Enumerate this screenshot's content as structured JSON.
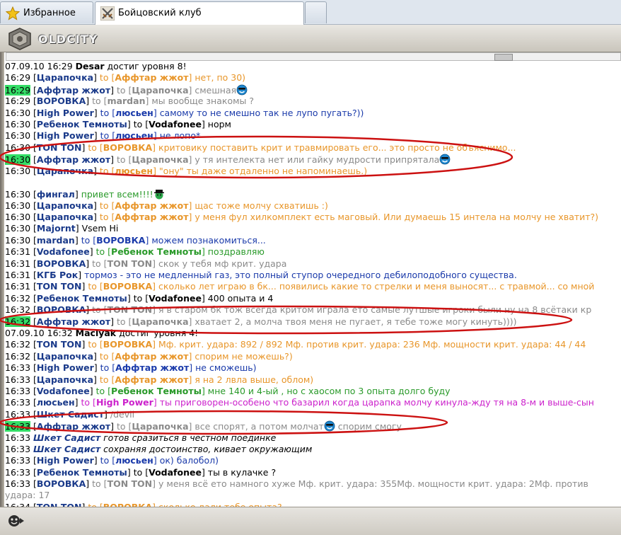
{
  "tabs": [
    {
      "label": "Избранное",
      "icon": "star-icon"
    },
    {
      "label": "Бойцовский клуб",
      "icon": "crossed-swords-icon"
    },
    {
      "label": "",
      "icon": "new-tab-icon"
    }
  ],
  "site": {
    "logo_text": "OLDCITY"
  },
  "colors": {
    "highlight_time": "#33dd66",
    "nick": "#1a3a8a",
    "target": "#8a8a8a",
    "circle": "#cc1111"
  },
  "messages": [
    {
      "time": "07.09.10 16:29",
      "hl": false,
      "nick": "Desar",
      "sys": true,
      "text": " достиг уровня 8!",
      "color": "#000000"
    },
    {
      "time": "16:29",
      "hl": false,
      "nick": "Царапочка",
      "to": "Аффтар жжот",
      "text": "нет, по 30)",
      "color": "#e8962a"
    },
    {
      "time": "16:29",
      "hl": true,
      "nick": "Аффтар жжот",
      "to": "Царапочка",
      "text": "смешная",
      "color": "#8a8a8a",
      "smile": "grin"
    },
    {
      "time": "16:29",
      "hl": false,
      "nick": "ВОРОВКА",
      "to": "mardan",
      "text": "мы вообще знакомы ?",
      "color": "#8a8a8a"
    },
    {
      "time": "16:30",
      "hl": false,
      "nick": "High Power",
      "to": "люсьен",
      "text": "самому то не смешно так не лупо пугать?))",
      "color": "#1a3aaa"
    },
    {
      "time": "16:30",
      "hl": false,
      "nick": "Ребенок Темноты",
      "to": "Vodafonee",
      "text": "норм",
      "color": "#000000"
    },
    {
      "time": "16:30",
      "hl": false,
      "nick": "High Power",
      "to": "люсьен",
      "text": "не лопо*",
      "color": "#1a3aaa"
    },
    {
      "time": "16:30",
      "hl": false,
      "nick": "TON TON",
      "to": "ВОРОВКА",
      "text": "критовику поставить крит и травмировать его... это просто не объяснимо...",
      "color": "#e8962a"
    },
    {
      "time": "16:30",
      "hl": true,
      "nick": "Аффтар жжот",
      "to": "Царапочка",
      "text": "у тя интелекта нет или гайку мудрости припрятала",
      "color": "#8a8a8a",
      "smile": "grin"
    },
    {
      "time": "16:30",
      "hl": false,
      "nick": "Царапочка",
      "to": "люсьен",
      "text": "\"ону\" ты даже отдаленно не напоминаешь.)",
      "color": "#e8962a"
    },
    {
      "spacer": true
    },
    {
      "time": "16:30",
      "hl": false,
      "nick": "фингал",
      "text": "привет всем!!!!",
      "color": "#2a9a2a",
      "smile": "hat"
    },
    {
      "time": "16:30",
      "hl": false,
      "nick": "Царапочка",
      "to": "Аффтар жжот",
      "text": "щас тоже молчу схватишь :)",
      "color": "#e8962a"
    },
    {
      "time": "16:30",
      "hl": false,
      "nick": "Царапочка",
      "to": "Аффтар жжот",
      "text": "у меня фул хилкомплект есть маговый. Или думаешь 15 интела на молчу не хватит?)",
      "color": "#e8962a"
    },
    {
      "time": "16:30",
      "hl": false,
      "nick": "Majornt",
      "text": "Vsem Hi",
      "color": "#000000"
    },
    {
      "time": "16:30",
      "hl": false,
      "nick": "mardan",
      "to": "ВОРОВКА",
      "text": "можем познакомиться...",
      "color": "#1a3aaa"
    },
    {
      "time": "16:31",
      "hl": false,
      "nick": "Vodafonee",
      "to": "Ребенок Темноты",
      "text": "поздравляю",
      "color": "#2a9a2a"
    },
    {
      "time": "16:31",
      "hl": false,
      "nick": "ВОРОВКА",
      "to": "TON TON",
      "text": "скок у тебя мф крит. удара",
      "color": "#8a8a8a"
    },
    {
      "time": "16:31",
      "hl": false,
      "nick": "КГБ Рок",
      "text": "тормоз - это не медленный газ, это полный ступор очередного дебилоподобного существа.",
      "color": "#1a3aaa"
    },
    {
      "time": "16:31",
      "hl": false,
      "nick": "TON TON",
      "to": "ВОРОВКА",
      "text": "сколько лет играю в бк... появились какие то стрелки и меня выносят... с травмой... со мной",
      "color": "#e8962a"
    },
    {
      "time": "16:32",
      "hl": false,
      "nick": "Ребенок Темноты",
      "to": "Vodafonee",
      "text": "400 опыта и 4",
      "color": "#000000"
    },
    {
      "time": "16:32",
      "hl": false,
      "nick": "ВОРОВКА",
      "to": "TON TON",
      "text": "я в старом бк тож всёгда критом играла ето самые лутшые игроки были ну на 8 всётаки кр",
      "color": "#8a8a8a"
    },
    {
      "time": "16:32",
      "hl": true,
      "nick": "Аффтар жжот",
      "to": "Царапочка",
      "text": "хватает 2, а молча твоя меня не пугает, я тебе тоже могу кинуть))))",
      "color": "#8a8a8a"
    },
    {
      "time": "07.09.10 16:32",
      "hl": false,
      "nick": "Maclyak",
      "sys": true,
      "text": " достиг уровня 4!",
      "color": "#000000"
    },
    {
      "time": "16:32",
      "hl": false,
      "nick": "TON TON",
      "to": "ВОРОВКА",
      "text": "Мф. крит. удара: 892 / 892 Мф. против крит. удара: 236 Мф. мощности крит. удара: 44 / 44",
      "color": "#e8962a"
    },
    {
      "time": "16:32",
      "hl": false,
      "nick": "Царапочка",
      "to": "Аффтар жжот",
      "text": "спорим не можешь?)",
      "color": "#e8962a"
    },
    {
      "time": "16:33",
      "hl": false,
      "nick": "High Power",
      "to": "Аффтар жжот",
      "text": "не сможешь)",
      "color": "#1a3aaa"
    },
    {
      "time": "16:33",
      "hl": false,
      "nick": "Царапочка",
      "to": "Аффтар жжот",
      "text": "я на 2 лвла выше, облом)",
      "color": "#e8962a"
    },
    {
      "time": "16:33",
      "hl": false,
      "nick": "Vodafonee",
      "to": "Ребенок Темноты",
      "text": "мне 140 и 4-ый , но с хаосом по 3 опыта долго буду",
      "color": "#2a9a2a"
    },
    {
      "time": "16:33",
      "hl": false,
      "nick": "люсьен",
      "to": "High Power",
      "text": "ты приговорен-особено что базарил когда царапка молчу кинула-жду тя на 8-м и выше-сын",
      "color": "#cc22cc"
    },
    {
      "time": "16:33",
      "hl": false,
      "nick": "Шкет Садист",
      "text": "/devil",
      "color": "#8a8a8a"
    },
    {
      "time": "16:33",
      "hl": true,
      "nick": "Аффтар жжот",
      "to": "Царапочка",
      "text": "все спорят, а потом молчат",
      "text2": " спорим смогу",
      "color": "#8a8a8a",
      "smile": "grin"
    },
    {
      "time": "16:33",
      "hl": false,
      "nick": "Шкет Садист",
      "italic": true,
      "text": " готов сразиться в честном поединке",
      "color": "#000000"
    },
    {
      "time": "16:33",
      "hl": false,
      "nick": "Шкет Садист",
      "italic": true,
      "text": " сохраняя достоинство, кивает окружающим",
      "color": "#000000"
    },
    {
      "time": "16:33",
      "hl": false,
      "nick": "High Power",
      "to": "люсьен",
      "text": "ок) балобол)",
      "color": "#1a3aaa"
    },
    {
      "time": "16:33",
      "hl": false,
      "nick": "Ребенок Темноты",
      "to": "Vodafonee",
      "text": "ты в кулачке ?",
      "color": "#000000"
    },
    {
      "time": "16:33",
      "hl": false,
      "nick": "ВОРОВКА",
      "to": "TON TON",
      "text": "у меня всё ето намного хуже Мф. крит. удара: 355Мф. мощности крит. удара: 2Мф. против удара: 17",
      "color": "#8a8a8a",
      "wrap": true
    },
    {
      "time": "16:34",
      "hl": false,
      "nick": "TON TON",
      "to": "ВОРОВКА",
      "text": "сколько дали тебе опыта?",
      "color": "#e8962a"
    }
  ]
}
